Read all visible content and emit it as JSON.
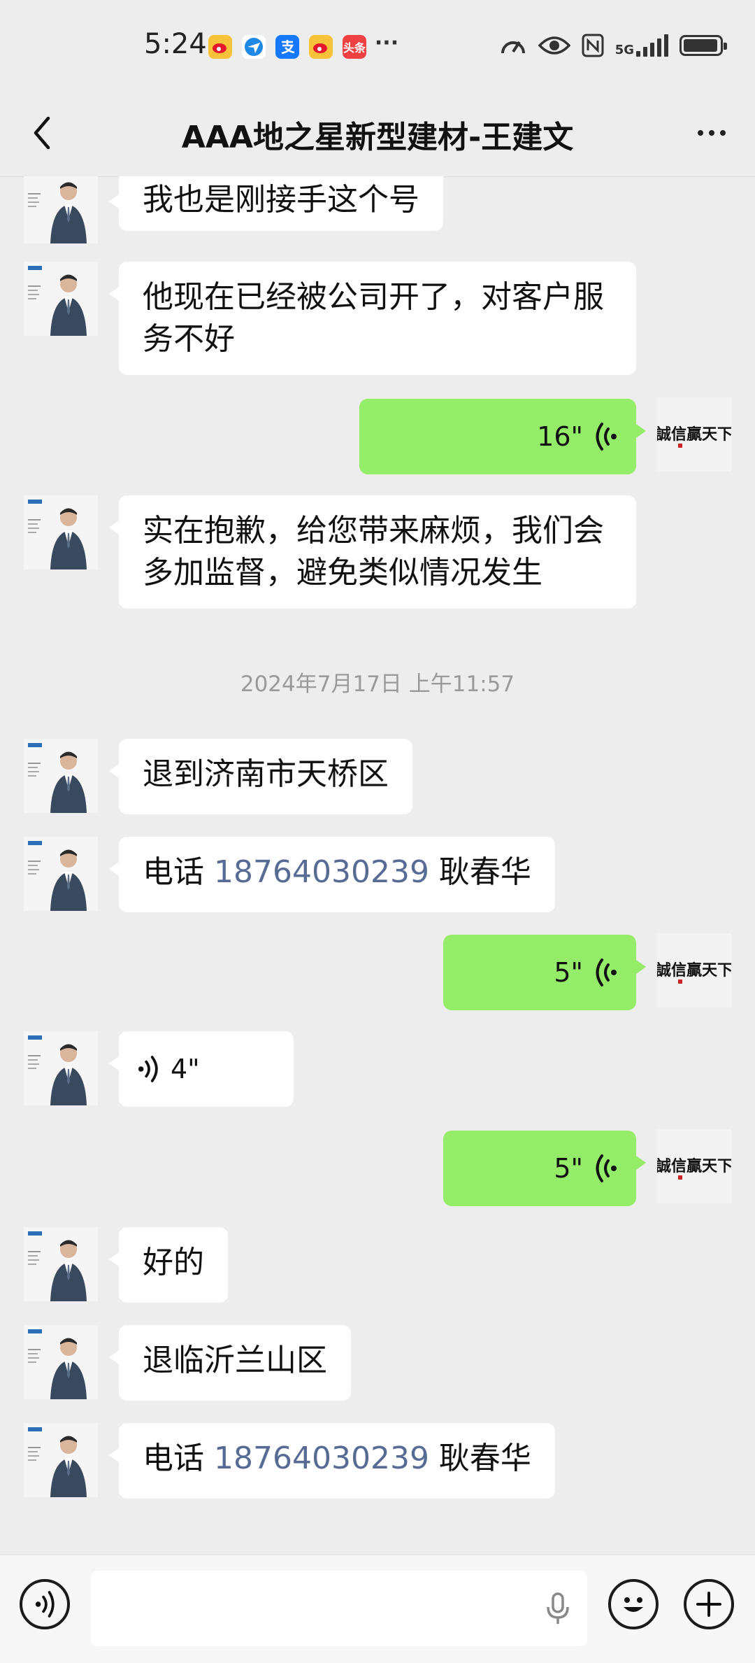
{
  "status_bar": {
    "time": "5:24",
    "app_icons": [
      "weibo-icon",
      "browser-icon",
      "alipay-icon",
      "weibo-icon",
      "toutiao-icon",
      "more-dots"
    ],
    "toutiao_label": "头条",
    "network": "5G",
    "right_icons": [
      "speedometer-icon",
      "eye-icon",
      "nfc-icon",
      "signal-icon",
      "battery-icon"
    ]
  },
  "header": {
    "title": "AAA地之星新型建材-王建文"
  },
  "messages": [
    {
      "side": "left",
      "type": "text",
      "text": "我也是刚接手这个号"
    },
    {
      "side": "left",
      "type": "text",
      "text": "他现在已经被公司开了，对客户服务不好"
    },
    {
      "side": "right",
      "type": "voice",
      "duration": "16\""
    },
    {
      "side": "left",
      "type": "text",
      "text": "实在抱歉，给您带来麻烦，我们会多加监督，避免类似情况发生"
    },
    {
      "type": "timestamp",
      "text": "2024年7月17日 上午11:57"
    },
    {
      "side": "left",
      "type": "text",
      "text": "退到济南市天桥区"
    },
    {
      "side": "left",
      "type": "phone",
      "prefix": "电话 ",
      "phone": "18764030239",
      "suffix": " 耿春华"
    },
    {
      "side": "right",
      "type": "voice",
      "duration": "5\""
    },
    {
      "side": "left",
      "type": "voice",
      "duration": "4\""
    },
    {
      "side": "right",
      "type": "voice",
      "duration": "5\""
    },
    {
      "side": "left",
      "type": "text",
      "text": "好的"
    },
    {
      "side": "left",
      "type": "text",
      "text": "退临沂兰山区"
    },
    {
      "side": "left",
      "type": "phone",
      "prefix": "电话 ",
      "phone": "18764030239",
      "suffix": " 耿春华"
    }
  ],
  "avatars": {
    "contact": "contact-avatar",
    "self_text": "誠信贏天下"
  },
  "input_bar": {
    "voice_toggle": "voice-mode-icon",
    "mic": "microphone-icon",
    "emoji": "emoji-icon",
    "plus": "plus-icon"
  },
  "colors": {
    "background": "#ededed",
    "bubble_self": "#95ec69",
    "bubble_other": "#ffffff",
    "phone_link": "#576b95",
    "timestamp": "#9a9a9a"
  }
}
